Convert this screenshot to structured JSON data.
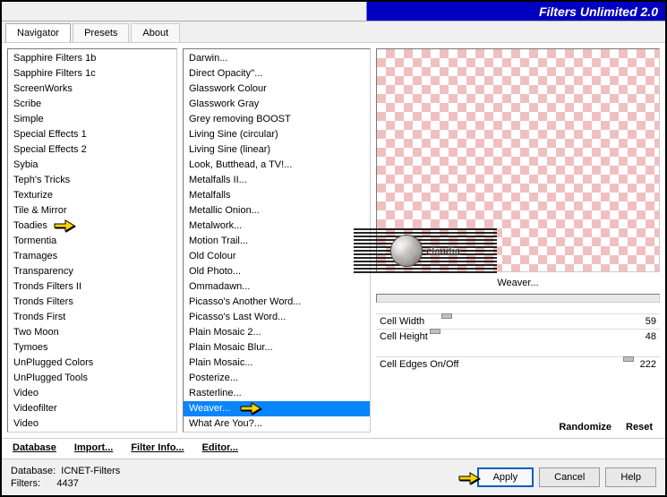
{
  "title": "Filters Unlimited 2.0",
  "tabs": [
    "Navigator",
    "Presets",
    "About"
  ],
  "activeTab": 0,
  "leftList": [
    "Sapphire Filters 1b",
    "Sapphire Filters 1c",
    "ScreenWorks",
    "Scribe",
    "Simple",
    "Special Effects 1",
    "Special Effects 2",
    "Sybia",
    "Teph's Tricks",
    "Texturize",
    "Tile & Mirror",
    "Toadies",
    "Tormentia",
    "Tramages",
    "Transparency",
    "Tronds Filters II",
    "Tronds Filters",
    "Tronds First",
    "Two Moon",
    "Tymoes",
    "UnPlugged Colors",
    "UnPlugged Tools",
    "Video",
    "Videofilter",
    "Video"
  ],
  "leftPointerIndex": 11,
  "midList": [
    "Darwin...",
    "Direct Opacity''...",
    "Glasswork Colour",
    "Glasswork Gray",
    "Grey removing BOOST",
    "Living Sine (circular)",
    "Living Sine (linear)",
    "Look, Butthead, a TV!...",
    "Metalfalls II...",
    "Metalfalls",
    "Metallic Onion...",
    "Metalwork...",
    "Motion Trail...",
    "Old Colour",
    "Old Photo...",
    "Ommadawn...",
    "Picasso's Another Word...",
    "Picasso's Last Word...",
    "Plain Mosaic 2...",
    "Plain Mosaic Blur...",
    "Plain Mosaic...",
    "Posterize...",
    "Rasterline...",
    "Weaver...",
    "What Are You?..."
  ],
  "midSelectedIndex": 23,
  "midPointerIndex": 23,
  "filterName": "Weaver...",
  "sliders": [
    {
      "label": "Cell Width",
      "value": 59,
      "pos": 23
    },
    {
      "label": "Cell Height",
      "value": 48,
      "pos": 19
    },
    {
      "label": "Cell Edges On/Off",
      "value": 222,
      "pos": 87
    }
  ],
  "midButtons": {
    "database": "Database",
    "import": "Import...",
    "filterinfo": "Filter Info...",
    "editor": "Editor..."
  },
  "rightButtons": {
    "randomize": "Randomize",
    "reset": "Reset"
  },
  "footer": {
    "dbLabel": "Database:",
    "dbValue": "ICNET-Filters",
    "filtLabel": "Filters:",
    "filtValue": "4437",
    "apply": "Apply",
    "cancel": "Cancel",
    "help": "Help"
  },
  "watermark": "claudia"
}
